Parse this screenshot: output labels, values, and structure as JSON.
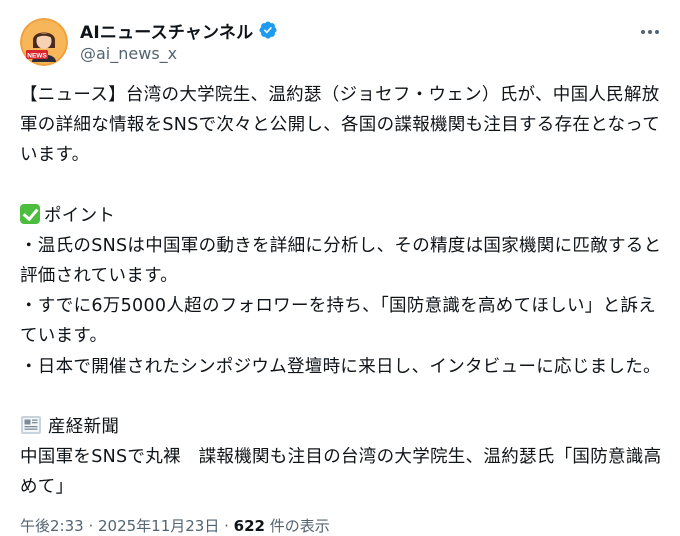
{
  "header": {
    "display_name": "AIニュースチャンネル",
    "handle": "@ai_news_x",
    "avatar_badge": "NEWS"
  },
  "body": {
    "intro": "【ニュース】台湾の大学院生、温約瑟（ジョセフ・ウェン）氏が、中国人民解放軍の詳細な情報をSNSで次々と公開し、各国の諜報機関も注目する存在となっています。",
    "points_heading": "ポイント",
    "points": [
      "・温氏のSNSは中国軍の動きを詳細に分析し、その精度は国家機関に匹敵すると評価されています。",
      "・すでに6万5000人超のフォロワーを持ち、「国防意識を高めてほしい」と訴えています。",
      "・日本で開催されたシンポジウム登壇時に来日し、インタビューに応じました。"
    ],
    "source_name": "産経新聞",
    "source_headline": "中国軍をSNSで丸裸　諜報機関も注目の台湾の大学院生、温約瑟氏「国防意識高めて」"
  },
  "footer": {
    "timestamp": "午後2:33 · 2025年11月23日 · ",
    "views_count": "622",
    "views_label": " 件の表示"
  },
  "colors": {
    "text": "#0f1419",
    "secondary": "#536471",
    "verified": "#1d9bf0",
    "check": "#4dbd3f",
    "avatar_bg": "#f28c28"
  },
  "icons": [
    "verified-badge-icon",
    "more-options-icon",
    "check-mark-icon",
    "newspaper-icon"
  ]
}
